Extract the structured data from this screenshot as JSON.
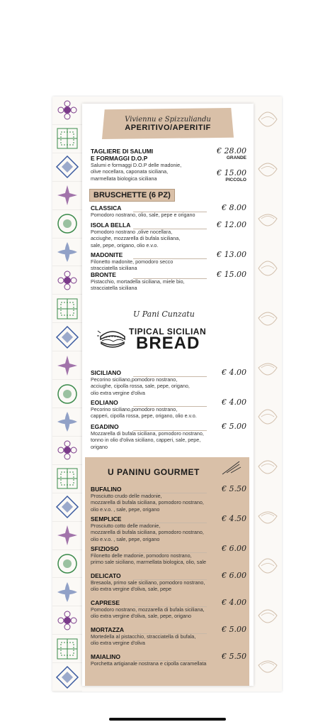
{
  "header": {
    "script_title": "Viviennu e Spizzuliandu",
    "title": "APERITIVO/APERITIF"
  },
  "taglieri": {
    "name_line1": "TAGLIERE DI SALUMI",
    "name_line2": "E FORMAGGI D.O.P",
    "desc": [
      "Salumi e formaggi D.O.P delle madonie,",
      "olive nocellara, caponata siciliana,",
      "marmellata biologica siciliana"
    ],
    "price_large": "€ 28.00",
    "label_large": "GRANDE",
    "price_small": "€ 15.00",
    "label_small": "PICCOLO"
  },
  "bruschette": {
    "heading": "BRUSCHETTE (6 PZ)",
    "items": [
      {
        "name": "CLASSICA",
        "desc": [
          "Pomodoro nostrano, olio, sale, pepe e origano"
        ],
        "price": "€ 8.00"
      },
      {
        "name": "ISOLA BELLA",
        "desc": [
          "Pomodoro nostrano ,olive nocellara,",
          "acciughe, mozzarella di bufala siciliana,",
          "sale, pepe, origano, olio e.v.o."
        ],
        "price": "€ 12.00"
      },
      {
        "name": "MADONITE",
        "desc": [
          "Filonetto madonite, pomodoro secco",
          "stracciatella siciliana"
        ],
        "price": "€ 13.00"
      },
      {
        "name": "BRONTE",
        "desc": [
          "Pistacchio, mortadella siciliana, miele bio,",
          "stracciatella siciliana"
        ],
        "price": "€ 15.00"
      }
    ]
  },
  "bread": {
    "script_title": "U Pani Cunzatu",
    "title_line1": "TIPICAL SICILIAN",
    "title_line2": "BREAD",
    "items": [
      {
        "name": "SICILIANO",
        "desc": [
          "Pecorino siciliano,pomodoro nostrano,",
          "acciughe, cipolla rossa, sale, pepe, origano,",
          "olio extra vergine d'oliva"
        ],
        "price": "€ 4.00"
      },
      {
        "name": "EOLIANO",
        "desc": [
          "Pecorino siciliano,pomodoro nostrano,",
          "capperi, cipolla rossa, pepe, origano, olio e.v.o."
        ],
        "price": "€ 4.00"
      },
      {
        "name": "EGADINO",
        "desc": [
          "Mozzarella di bufala siciliana, pomodoro nostrano,",
          "tonno in olio d'oliva siciliano, capperi, sale, pepe,",
          "origano"
        ],
        "price": "€ 5.00"
      }
    ]
  },
  "gourmet": {
    "heading": "U PANINU GOURMET",
    "items": [
      {
        "name": "BUFALINO",
        "desc": [
          "Prosciutto crudo delle madonie,",
          "mozzarella di bufala siciliana, pomodoro nostrano,",
          "olio e.v.o. , sale, pepe, origano"
        ],
        "price": "€ 5.50"
      },
      {
        "name": "SEMPLICE",
        "desc": [
          "Prosciutto cotto delle madonie,",
          "mozzarella di bufala siciliana, pomodoro nostrano,",
          "olio e.v.o. , sale, pepe, origano"
        ],
        "price": "€ 4.50"
      },
      {
        "name": "SFIZIOSO",
        "desc": [
          "Filonetto delle madonie, pomodoro nostrano,",
          "primo sale siciliano, marmellata biologica, olio, sale"
        ],
        "price": "€ 6.00"
      },
      {
        "name": "DELICATO",
        "desc": [
          "Bresaola, primo sale siciliano, pomodoro nostrano,",
          "olio extra vergine d'oliva, sale, pepe"
        ],
        "price": "€ 6.00"
      },
      {
        "name": "CAPRESE",
        "desc": [
          "Pomodoro nostrano, mozzarella di bufala siciliana,",
          "olio extra vergine d'oliva, sale, pepe, origano"
        ],
        "price": "€ 4.00"
      },
      {
        "name": "MORTAZZA",
        "desc": [
          "Mortedella al pistacchio, stracciatella di bufala,",
          "olio extra vergine d'oliva"
        ],
        "price": "€ 5.00"
      },
      {
        "name": "MAIALINO",
        "desc": [
          "Porchetta artigianale nostrana e cipolla caramellata"
        ],
        "price": "€ 5.50"
      }
    ]
  },
  "colors": {
    "banner": "#d9c0a8",
    "tile_accents": [
      "#7a3a8a",
      "#c0392b",
      "#3a8a4a",
      "#d88a3a",
      "#3a5aa0",
      "#c8a040"
    ]
  }
}
